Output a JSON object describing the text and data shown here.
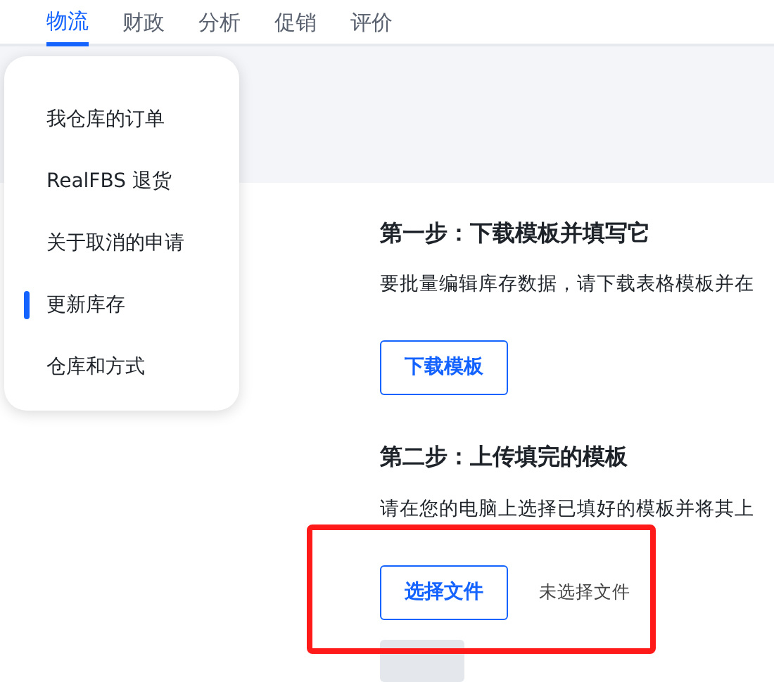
{
  "tabs": [
    {
      "label": "物流",
      "selected": true
    },
    {
      "label": "财政",
      "selected": false
    },
    {
      "label": "分析",
      "selected": false
    },
    {
      "label": "促销",
      "selected": false
    },
    {
      "label": "评价",
      "selected": false
    }
  ],
  "menu": {
    "items": [
      {
        "label": "我仓库的订单",
        "selected": false
      },
      {
        "label": "RealFBS 退货",
        "selected": false
      },
      {
        "label": "关于取消的申请",
        "selected": false
      },
      {
        "label": "更新库存",
        "selected": true
      },
      {
        "label": "仓库和方式",
        "selected": false
      }
    ]
  },
  "steps": [
    {
      "title": "第一步：下载模板并填写它",
      "text": "要批量编辑库存数据，请下载表格模板并在",
      "button": "下载模板"
    },
    {
      "title": "第二步：上传填完的模板",
      "text": "请在您的电脑上选择已填好的模板并将其上",
      "button": "选择文件",
      "file_status": "未选择文件"
    }
  ],
  "upload_button": {
    "disabled": true
  },
  "annotations": [
    {
      "kind": "frame"
    }
  ]
}
